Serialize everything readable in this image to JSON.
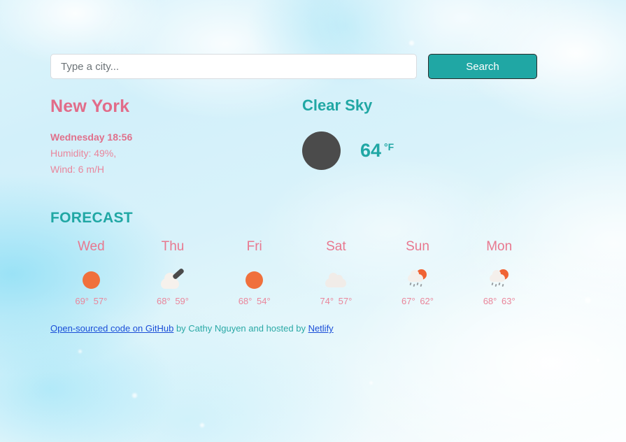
{
  "search": {
    "placeholder": "Type a city...",
    "value": "",
    "button_label": "Search"
  },
  "current": {
    "city": "New York",
    "datetime": "Wednesday 18:56",
    "humidity": "Humidity: 49%,",
    "wind": "Wind: 6 m/H",
    "condition": "Clear Sky",
    "temperature": "64",
    "unit": "°F",
    "icon": "broken-image-icon"
  },
  "forecast": {
    "title": "FORECAST",
    "days": [
      {
        "label": "Wed",
        "icon": "sun-icon",
        "max": "69°",
        "min": "57°"
      },
      {
        "label": "Thu",
        "icon": "broken-image-icon",
        "max": "68°",
        "min": "59°"
      },
      {
        "label": "Fri",
        "icon": "sun-icon",
        "max": "68°",
        "min": "54°"
      },
      {
        "label": "Sat",
        "icon": "cloud-icon",
        "max": "74°",
        "min": "57°"
      },
      {
        "label": "Sun",
        "icon": "sun-rain-icon",
        "max": "67°",
        "min": "62°"
      },
      {
        "label": "Mon",
        "icon": "sun-rain-icon",
        "max": "68°",
        "min": "63°"
      }
    ]
  },
  "footer": {
    "link_github": "Open-sourced code on GitHub",
    "text_middle": " by Cathy Nguyen and hosted by ",
    "link_netlify": "Netlify"
  },
  "colors": {
    "accent_teal": "#20a7a4",
    "accent_pink": "#e26c89",
    "sun_orange": "#f0703c",
    "link_blue": "#1a4ed8"
  }
}
